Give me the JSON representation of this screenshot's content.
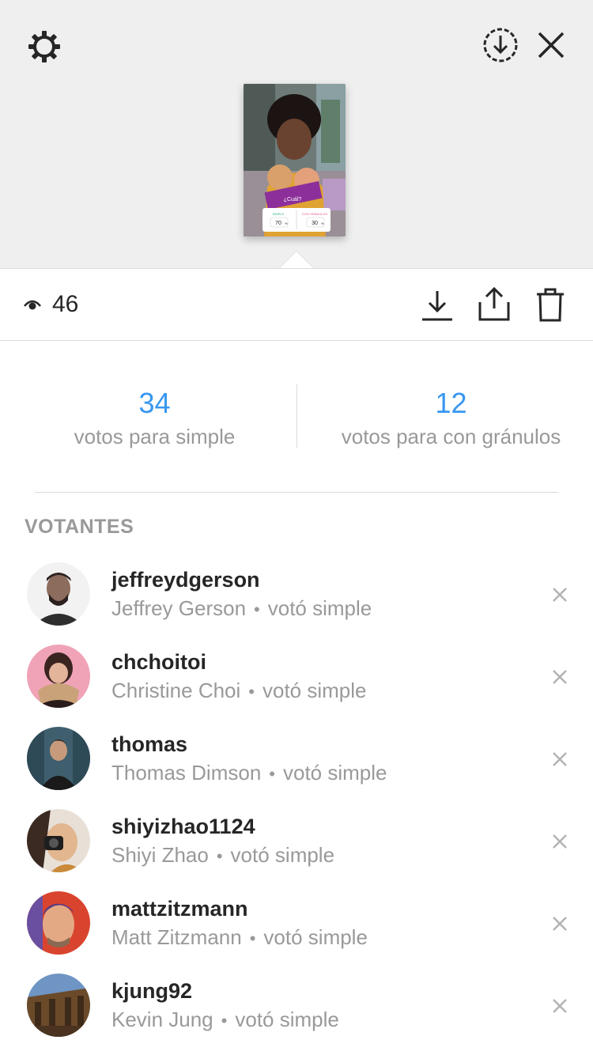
{
  "header": {
    "settings_icon": "gear-icon",
    "save_icon": "download-circle-icon",
    "close_icon": "close-icon"
  },
  "story": {
    "poll_question": "¿Cuál?",
    "option_left": "SIMPLE",
    "option_left_pct": "70",
    "option_right": "CON GRÁNULOS",
    "option_right_pct": "30",
    "pct_sign": "%"
  },
  "toolbar": {
    "views_icon": "eye-icon",
    "views_count": "46",
    "download_icon": "download-icon",
    "share_icon": "share-icon",
    "delete_icon": "trash-icon"
  },
  "results": {
    "left": {
      "count": "34",
      "label": "votos para simple"
    },
    "right": {
      "count": "12",
      "label": "votos para con gránulos"
    }
  },
  "voters_title": "VOTANTES",
  "voters": [
    {
      "username": "jeffreydgerson",
      "name": "Jeffrey Gerson",
      "vote": "votó simple",
      "dot": "•"
    },
    {
      "username": "chchoitoi",
      "name": "Christine Choi",
      "vote": "votó simple",
      "dot": "•"
    },
    {
      "username": "thomas",
      "name": "Thomas Dimson",
      "vote": "votó simple",
      "dot": "•"
    },
    {
      "username": "shiyizhao1124",
      "name": "Shiyi Zhao",
      "vote": "votó simple",
      "dot": "•"
    },
    {
      "username": "mattzitzmann",
      "name": "Matt Zitzmann",
      "vote": "votó simple",
      "dot": "•"
    },
    {
      "username": "kjung92",
      "name": "Kevin Jung",
      "vote": "votó simple",
      "dot": "•"
    }
  ],
  "colors": {
    "accent": "#3897f0",
    "secondary_text": "#999999",
    "primary_text": "#262626"
  }
}
